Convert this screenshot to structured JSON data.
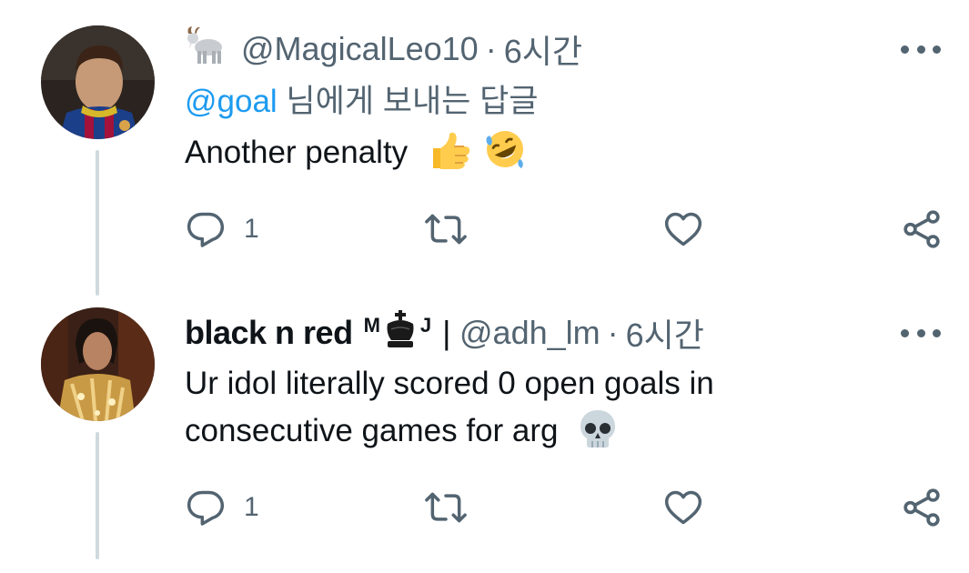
{
  "tweets": [
    {
      "emoji_badge": "goat",
      "handle": "@MagicalLeo10",
      "separator": "·",
      "time": "6시간",
      "reply_mention": "@goal",
      "reply_suffix": " 님에게 보내는 답글",
      "text": "Another penalty",
      "text_emojis": [
        "thumbs-up",
        "rolling-on-floor-laughing"
      ],
      "actions": {
        "reply_count": "1",
        "retweet_count": "",
        "like_count": ""
      }
    },
    {
      "display_name": "black n red",
      "name_suffix_m": "M",
      "name_suffix_j": "J",
      "name_bar": "|",
      "handle": "@adh_lm",
      "separator": "·",
      "time": "6시간",
      "text_line1": "Ur idol literally scored 0 open goals in",
      "text_line2": "consecutive games for arg",
      "text_emojis": [
        "skull"
      ],
      "actions": {
        "reply_count": "1",
        "retweet_count": "",
        "like_count": ""
      }
    }
  ],
  "colors": {
    "accent": "#1d9bf0",
    "muted": "#536471",
    "text": "#0f1419",
    "thread_line": "#cfd9de"
  }
}
